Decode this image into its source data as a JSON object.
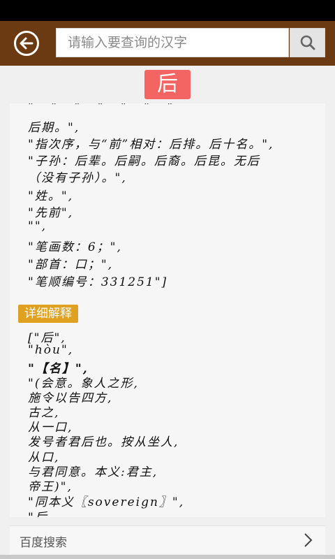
{
  "header": {
    "search_placeholder": "请输入要查询的汉字"
  },
  "character": "后",
  "basic_lines": [
    "后期。\",",
    "\"指次序，与“前”相对：后排。后十名。\",",
    "\"子孙：后辈。后嗣。后裔。后昆。无后",
    "（没有子孙）。\",",
    "\"姓。\",",
    "\"先前\",",
    "\"\",",
    "\"笔画数：6；\",",
    "\"部首：口；\",",
    "\"笔顺编号：331251\"]"
  ],
  "detail_section": {
    "label": "详细解释",
    "lines": [
      "[\"后\",",
      "\"hòu\",",
      "\"【名】\",",
      "\"(会意。象人之形,",
      "施令以告四方,",
      "古之,",
      "从一口,",
      "发号者君后也。按从坐人,",
      "从口,",
      "与君同意。本义:君主,",
      "帝王)\",",
      "\"同本义〖sovereign〗\",",
      "\"后,"
    ]
  },
  "bottom": {
    "label": "百度搜索"
  },
  "icons": {
    "back": "arrow-left-circle-icon",
    "search": "magnifier-icon",
    "more": "chevron-right-icon"
  },
  "colors": {
    "header_bg": "#6b3a12",
    "badge_bg": "#f26562",
    "section_label_bg": "#e0a020"
  }
}
